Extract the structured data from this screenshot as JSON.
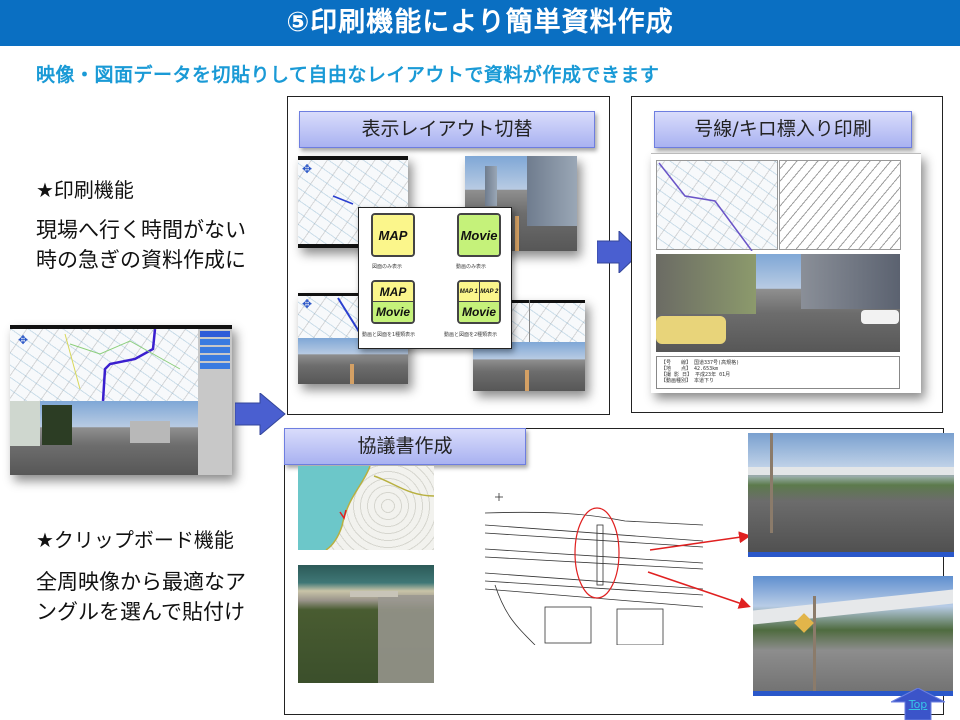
{
  "slide": {
    "title": "⑤印刷機能により簡単資料作成",
    "subtitle": "映像・図面データを切貼りして自由なレイアウトで資料が作成できます"
  },
  "left": {
    "print_heading": "★印刷機能",
    "print_desc_lines": [
      "現場へ行く時間がない",
      "時の急ぎの資料作成に"
    ],
    "clipboard_heading": "★クリップボード機能",
    "clipboard_desc_lines": [
      "全周映像から最適なア",
      "ングルを選んで貼付け"
    ]
  },
  "panels": {
    "layout_switch": {
      "label": "表示レイアウト切替",
      "buttons": [
        {
          "segments": [
            "MAP"
          ],
          "caption": "図面のみ表示"
        },
        {
          "segments": [
            "Movie"
          ],
          "caption": "動画のみ表示"
        },
        {
          "segments": [
            "MAP",
            "Movie"
          ],
          "caption": "動画と図面を1種類表示"
        },
        {
          "segments": [
            "MAP 1",
            "MAP 2",
            "Movie"
          ],
          "caption": "動画と図面を2種類表示"
        }
      ]
    },
    "route_print": {
      "label": "号線/キロ標入り印刷",
      "info": [
        {
          "key": "【号　　線】",
          "value": "国道337号(高規格)"
        },
        {
          "key": "【地　　点】",
          "value": "42.653km"
        },
        {
          "key": "【撮 影 日】",
          "value": "平成23年 01月"
        },
        {
          "key": "【動画種別】",
          "value": "本道下り"
        }
      ]
    },
    "agreement": {
      "label": "協議書作成"
    }
  },
  "nav": {
    "top_label": "Top"
  },
  "colors": {
    "title_bg": "#0a6fc2",
    "subtitle": "#1a9ad6",
    "arrow": "#4a5fd0",
    "label_gradient_top": "#d9dcfb",
    "label_gradient_bottom": "#a9b2f1",
    "annotation_red": "#e02020"
  }
}
